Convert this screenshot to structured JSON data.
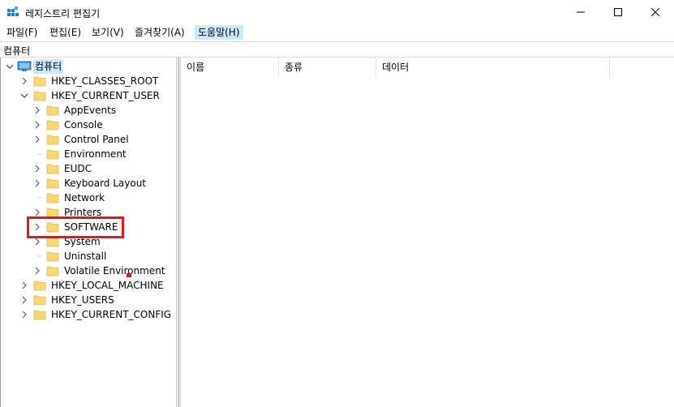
{
  "window": {
    "title": "레지스트리 편집기",
    "icon": "regedit-icon"
  },
  "menu": [
    {
      "label": "파일(F)"
    },
    {
      "label": "편집(E)"
    },
    {
      "label": "보기(V)"
    },
    {
      "label": "즐겨찾기(A)"
    },
    {
      "label": "도움말(H)",
      "active": true
    }
  ],
  "address": {
    "path": "컴퓨터"
  },
  "tree": {
    "root": {
      "label": "컴퓨터",
      "icon": "computer-icon",
      "expanded": true
    },
    "hives": [
      {
        "label": "HKEY_CLASSES_ROOT"
      },
      {
        "label": "HKEY_CURRENT_USER",
        "expanded": true
      },
      {
        "label": "HKEY_LOCAL_MACHINE"
      },
      {
        "label": "HKEY_USERS"
      },
      {
        "label": "HKEY_CURRENT_CONFIG"
      }
    ],
    "hkcu_children": [
      {
        "label": "AppEvents",
        "has_children": true
      },
      {
        "label": "Console",
        "has_children": true
      },
      {
        "label": "Control Panel",
        "has_children": true
      },
      {
        "label": "Environment",
        "has_children": false
      },
      {
        "label": "EUDC",
        "has_children": true
      },
      {
        "label": "Keyboard Layout",
        "has_children": true
      },
      {
        "label": "Network",
        "has_children": false
      },
      {
        "label": "Printers",
        "has_children": true
      },
      {
        "label": "SOFTWARE",
        "has_children": true,
        "highlighted": true
      },
      {
        "label": "System",
        "has_children": true
      },
      {
        "label": "Uninstall",
        "has_children": false
      },
      {
        "label": "Volatile Environment",
        "has_children": true
      }
    ]
  },
  "list": {
    "columns": [
      {
        "label": "이름"
      },
      {
        "label": "종류"
      },
      {
        "label": "데이터"
      }
    ]
  },
  "colors": {
    "selection": "#cce8ff",
    "folder": "#f8d775",
    "folder_dark": "#e0b84a",
    "highlight": "#e4161c"
  }
}
